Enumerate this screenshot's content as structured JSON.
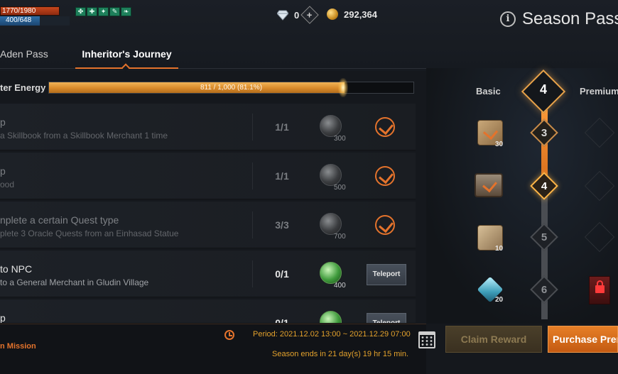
{
  "hud": {
    "hp": "1770/1980",
    "mp": "400/648",
    "buffs": [
      "✤",
      "✚",
      "✦",
      "✎",
      "❧"
    ],
    "diamonds": "0",
    "plus": "+",
    "adena": "292,364"
  },
  "header": {
    "info": "i",
    "title": "Season Pass"
  },
  "tabs": {
    "aden": "Aden Pass",
    "journey": "Inheritor's Journey"
  },
  "energy": {
    "label": "ter Energy",
    "text": "811 / 1,000 (81.1%)",
    "percent": 81.1
  },
  "missions": [
    {
      "name": "p",
      "desc": "a Skillbook from a Skillbook Merchant 1 time",
      "count": "1/1",
      "reward": "300",
      "state": "done"
    },
    {
      "name": "p",
      "desc": "ood",
      "count": "1/1",
      "reward": "500",
      "state": "done"
    },
    {
      "name": "nplete a certain Quest type",
      "desc": "plete 3 Oracle Quests from an Einhasad Statue",
      "count": "3/3",
      "reward": "700",
      "state": "done"
    },
    {
      "name": " to NPC",
      "desc": "to a General Merchant in Gludin Village",
      "count": "0/1",
      "reward": "400",
      "state": "active",
      "button": "Teleport"
    },
    {
      "name": "p",
      "desc": "",
      "count": "0/1",
      "reward": "",
      "state": "active",
      "button": "Teleport"
    }
  ],
  "footer": {
    "mission_link": "n Mission",
    "period": "Period: 2021.12.02 13:00 ~ 2021.12.29 07:00",
    "season_ends": "Season ends in 21 day(s) 19 hr 15 min.",
    "claim": "Claim Reward",
    "purchase": "Purchase Premium"
  },
  "pass": {
    "basic_label": "Basic",
    "premium_label": "Premium",
    "current_level": "4",
    "levels": [
      {
        "num": "3",
        "reward_count": "30",
        "state": "reached"
      },
      {
        "num": "4",
        "reward_count": "",
        "state": "current"
      },
      {
        "num": "5",
        "reward_count": "10",
        "state": "locked"
      },
      {
        "num": "6",
        "reward_count": "20",
        "state": "locked"
      }
    ]
  },
  "colors": {
    "accent": "#e4732c",
    "energy": "#d98a2a",
    "teleport": "#3f4650",
    "lock": "#ff3a3a"
  }
}
